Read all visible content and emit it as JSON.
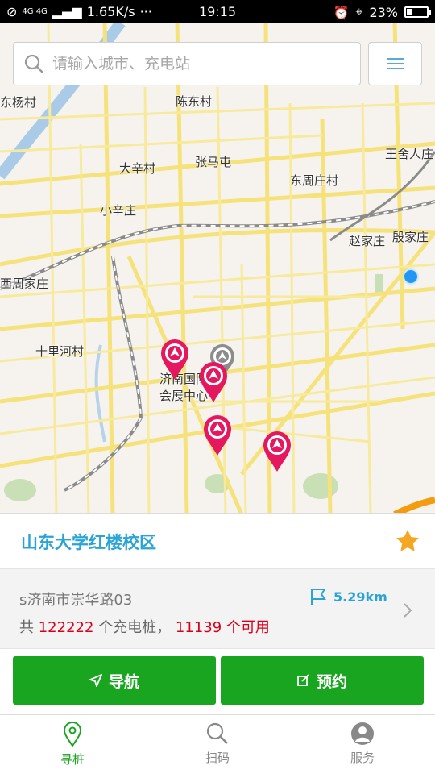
{
  "status_bar": {
    "network": "4G 4G",
    "speed": "1.65K/s",
    "more": "···",
    "time": "19:15",
    "battery": "23%"
  },
  "search": {
    "placeholder": "请输入城市、充电站"
  },
  "map": {
    "places": [
      {
        "name": "东杨村"
      },
      {
        "name": "陈东村"
      },
      {
        "name": "王舍人庄"
      },
      {
        "name": "大辛村"
      },
      {
        "name": "张马屯"
      },
      {
        "name": "东周庄村"
      },
      {
        "name": "小辛庄"
      },
      {
        "name": "赵家庄"
      },
      {
        "name": "殷家庄"
      },
      {
        "name": "西周家庄"
      },
      {
        "name": "十里河村"
      },
      {
        "name": "济南国际"
      },
      {
        "name": "会展中心"
      }
    ]
  },
  "station": {
    "name": "山东大学红楼校区",
    "address": "s济南市崇华路03",
    "distance": "5.29km",
    "count_prefix": "共",
    "total": "122222",
    "count_mid": "个充电桩，",
    "available": "11139",
    "count_suffix": "个可用",
    "favorite_color": "#f5a623"
  },
  "actions": {
    "navigate": "导航",
    "reserve": "预约",
    "color": "#1aa520"
  },
  "tabs": [
    {
      "label": "寻桩",
      "icon": "location-pin-icon",
      "active": true
    },
    {
      "label": "扫码",
      "icon": "search-icon",
      "active": false
    },
    {
      "label": "服务",
      "icon": "user-icon",
      "active": false
    }
  ]
}
